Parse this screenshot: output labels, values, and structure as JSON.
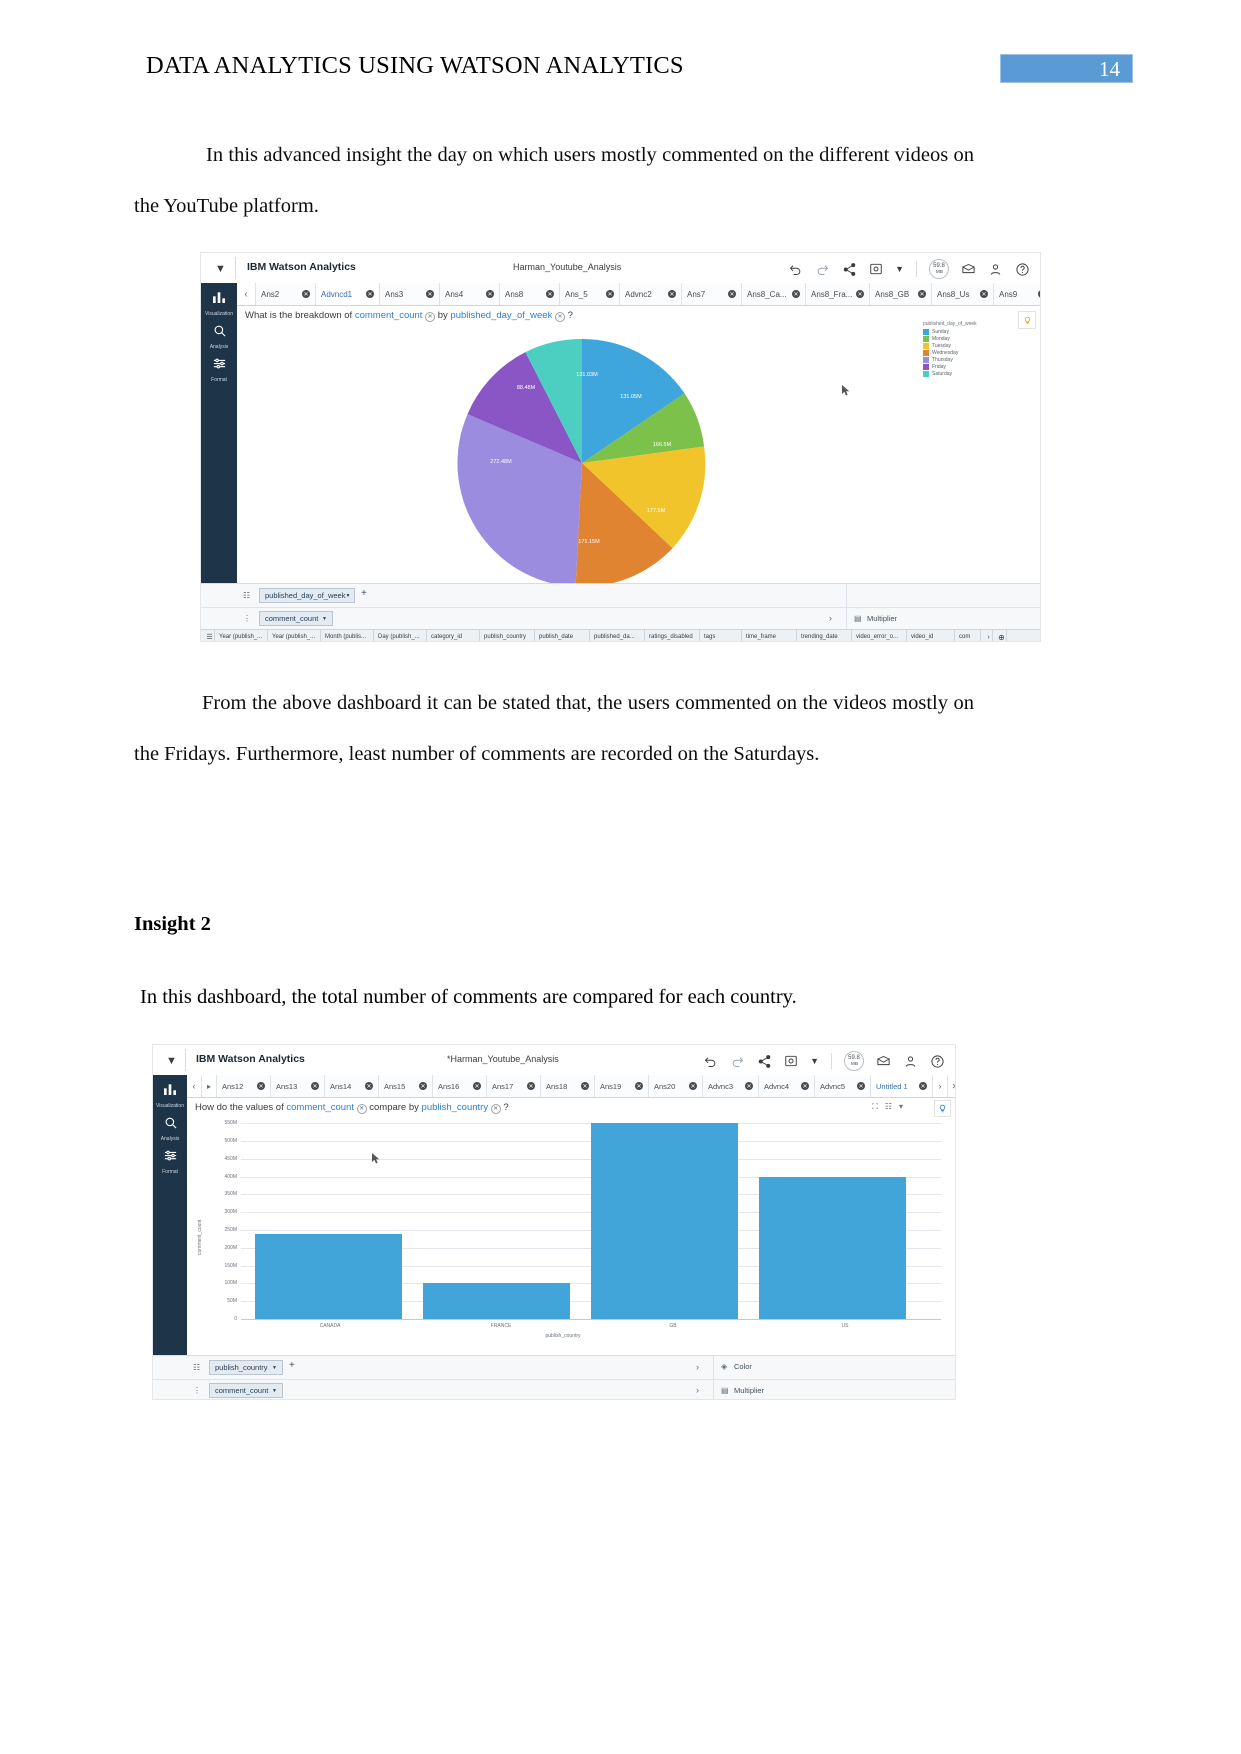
{
  "document": {
    "header_title": "DATA ANALYTICS USING WATSON ANALYTICS",
    "page_number": "14",
    "paragraph_1": "In this advanced insight the day on which users mostly commented on the different videos on the YouTube platform.",
    "paragraph_2": "From the above dashboard it can be stated that, the users commented on the videos mostly on the Fridays.   Furthermore, least number of comments are recorded on the Saturdays.",
    "insight_heading": "Insight 2",
    "paragraph_3": "In this dashboard, the total number of comments are compared for each country."
  },
  "screenshot_1": {
    "brand": "IBM Watson Analytics",
    "filename": "Harman_Youtube_Analysis",
    "memory_gauge": {
      "value": "59.8",
      "unit": "MB"
    },
    "toolbar_icons": [
      "undo-icon",
      "redo-icon",
      "share-icon",
      "snapshot-icon",
      "chevron-down-icon",
      "memory-gauge",
      "feedback-icon",
      "user-icon",
      "help-icon"
    ],
    "rail": [
      {
        "label": "Visualization",
        "icon": "bar-chart-icon"
      },
      {
        "label": "Analysis",
        "icon": "magnifier-icon"
      },
      {
        "label": "Format",
        "icon": "sliders-icon"
      }
    ],
    "tabs": [
      {
        "label": "Ans2",
        "active": false
      },
      {
        "label": "Advncd1",
        "active": true
      },
      {
        "label": "Ans3",
        "active": false
      },
      {
        "label": "Ans4",
        "active": false
      },
      {
        "label": "Ans8",
        "active": false
      },
      {
        "label": "Ans_5",
        "active": false
      },
      {
        "label": "Advnc2",
        "active": false
      },
      {
        "label": "Ans7",
        "active": false
      },
      {
        "label": "Ans8_Ca...",
        "active": false
      },
      {
        "label": "Ans8_Fra...",
        "active": false
      },
      {
        "label": "Ans8_GB",
        "active": false
      },
      {
        "label": "Ans8_Us",
        "active": false
      },
      {
        "label": "Ans9",
        "active": false
      }
    ],
    "question": {
      "prefix": "What is the breakdown of",
      "measure": "comment_count",
      "middle": "by",
      "dimension": "published_day_of_week",
      "suffix": "?"
    },
    "shelf": {
      "row1_pill": "published_day_of_week",
      "row1_plus": "+",
      "row2_pill": "comment_count",
      "row2_right_label": "Multiplier"
    },
    "grid_columns": [
      "Year (publish_...",
      "Year (publish_...",
      "Month (publis...",
      "Day (publish_...",
      "category_id",
      "publish_country",
      "publish_date",
      "published_da...",
      "ratings_disabled",
      "tags",
      "time_frame",
      "trending_date",
      "video_error_o...",
      "video_id",
      "com"
    ],
    "chart_data": {
      "type": "pie",
      "title": "What is the breakdown of comment_count by published_day_of_week?",
      "legend_title": "published_day_of_week",
      "legend_position": "right",
      "categories": [
        "Sunday",
        "Monday",
        "Tuesday",
        "Wednesday",
        "Thursday",
        "Friday",
        "Saturday"
      ],
      "values": [
        131.05,
        166.5,
        177.5,
        171.15,
        272.48,
        88.48,
        131.03
      ],
      "labels": [
        "131.05M",
        "166.5M",
        "177.5M",
        "171.15M",
        "272.48M",
        "88.48M",
        "131.03M"
      ],
      "colors": [
        "#3ea6dd",
        "#7cc24a",
        "#f2c42c",
        "#e08432",
        "#9b8ce0",
        "#8a55c4",
        "#4ccfc0"
      ],
      "ylabel": "comment_count",
      "xlabel": "published_day_of_week"
    }
  },
  "screenshot_2": {
    "brand": "IBM Watson Analytics",
    "filename": "*Harman_Youtube_Analysis",
    "memory_gauge": {
      "value": "59.8",
      "unit": "MB"
    },
    "rail": [
      {
        "label": "Visualization",
        "icon": "bar-chart-icon"
      },
      {
        "label": "Analysis",
        "icon": "magnifier-icon"
      },
      {
        "label": "Format",
        "icon": "sliders-icon"
      }
    ],
    "tabs": [
      {
        "label": "Ans12",
        "active": false
      },
      {
        "label": "Ans13",
        "active": false
      },
      {
        "label": "Ans14",
        "active": false
      },
      {
        "label": "Ans15",
        "active": false
      },
      {
        "label": "Ans16",
        "active": false
      },
      {
        "label": "Ans17",
        "active": false
      },
      {
        "label": "Ans18",
        "active": false
      },
      {
        "label": "Ans19",
        "active": false
      },
      {
        "label": "Ans20",
        "active": false
      },
      {
        "label": "Advnc3",
        "active": false
      },
      {
        "label": "Advnc4",
        "active": false
      },
      {
        "label": "Advnc5",
        "active": false
      },
      {
        "label": "Untitled 1",
        "active": true
      }
    ],
    "question": {
      "prefix": "How do the values of",
      "measure": "comment_count",
      "middle": "compare by",
      "dimension": "publish_country",
      "suffix": "?"
    },
    "shelf": {
      "row1_pill": "publish_country",
      "row1_plus": "+",
      "row1_right_label": "Color",
      "row2_pill": "comment_count",
      "row2_right_label": "Multiplier"
    },
    "chart_data": {
      "type": "bar",
      "title": "How do the values of comment_count compare by publish_country?",
      "categories": [
        "CANADA",
        "FRANCE",
        "GB",
        "US"
      ],
      "values": [
        240,
        100,
        550,
        400
      ],
      "series": [
        {
          "name": "comment_count",
          "values": [
            240,
            100,
            550,
            400
          ]
        }
      ],
      "xlabel": "publish_country",
      "ylabel": "comment_count",
      "ylim": [
        0,
        550
      ],
      "yticks": [
        "0",
        "50M",
        "100M",
        "150M",
        "200M",
        "250M",
        "300M",
        "350M",
        "400M",
        "450M",
        "500M",
        "550M"
      ],
      "ytick_values": [
        0,
        50,
        100,
        150,
        200,
        250,
        300,
        350,
        400,
        450,
        500,
        550
      ],
      "bar_color": "#41a5d9",
      "grid": true,
      "legend": "none"
    }
  }
}
